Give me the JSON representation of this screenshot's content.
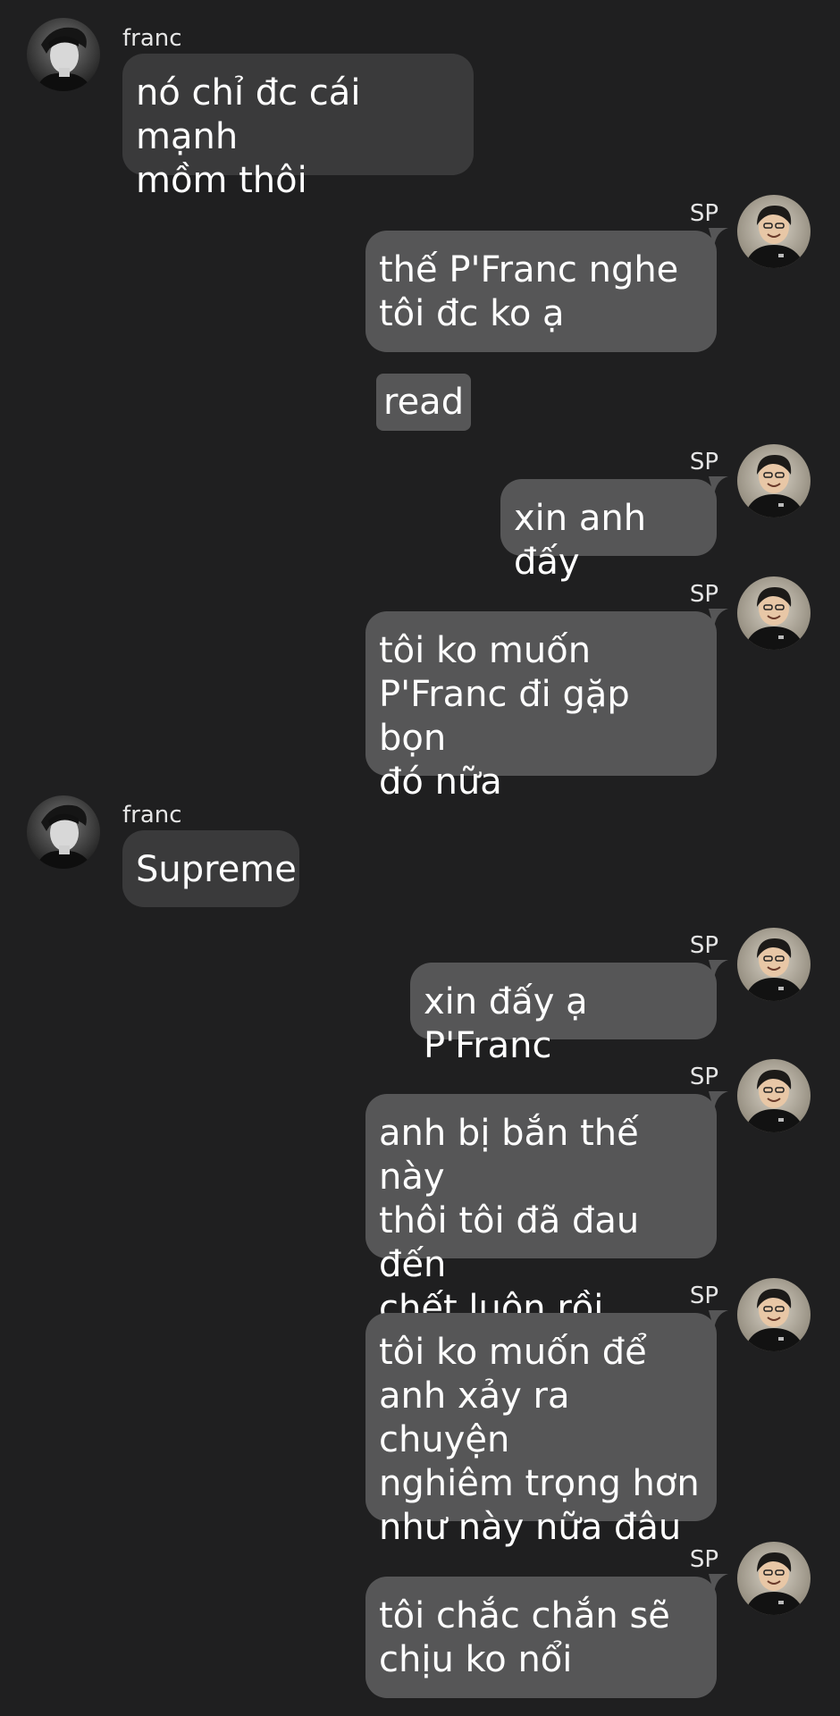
{
  "colors": {
    "background": "#1f1f20",
    "franc_bubble": "#3a3a3b",
    "sp_bubble": "#565657",
    "text": "#ffffff"
  },
  "messages": [
    {
      "sender": "franc",
      "name": "franc",
      "text": "nó chỉ đc cái mạnh\nmồm thôi",
      "avatar": "franc-avatar"
    },
    {
      "sender": "sp",
      "name": "SP",
      "text": "thế P'Franc nghe\ntôi đc ko ạ",
      "avatar": "sp-avatar"
    },
    {
      "sender": "system",
      "text": "read"
    },
    {
      "sender": "sp",
      "name": "SP",
      "text": "xin anh đấy",
      "avatar": "sp-avatar"
    },
    {
      "sender": "sp",
      "name": "SP",
      "text": "tôi ko muốn\nP'Franc đi gặp bọn\nđó nữa",
      "avatar": "sp-avatar"
    },
    {
      "sender": "franc",
      "name": "franc",
      "text": "Supreme",
      "avatar": "franc-avatar"
    },
    {
      "sender": "sp",
      "name": "SP",
      "text": "xin đấy ạ P'Franc",
      "avatar": "sp-avatar"
    },
    {
      "sender": "sp",
      "name": "SP",
      "text": "anh bị bắn thế này\nthôi tôi đã đau đến\nchết luôn rồi",
      "avatar": "sp-avatar"
    },
    {
      "sender": "sp",
      "name": "SP",
      "text": "tôi ko muốn để\nanh xảy ra chuyện\nnghiêm trọng hơn\nnhư này nữa đâu",
      "avatar": "sp-avatar"
    },
    {
      "sender": "sp",
      "name": "SP",
      "text": "tôi chắc chắn sẽ\nchịu ko nổi",
      "avatar": "sp-avatar"
    }
  ]
}
